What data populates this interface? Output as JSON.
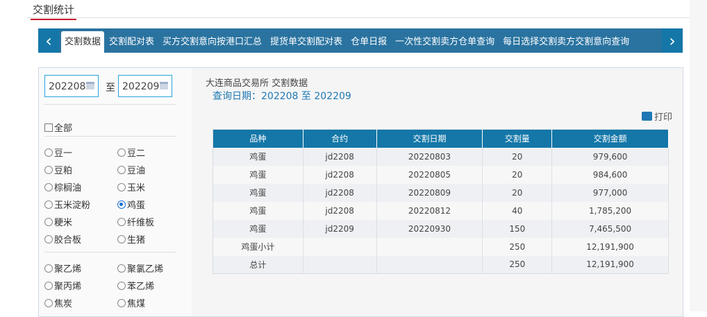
{
  "page_title": "交割统计",
  "tabs": [
    "交割数据",
    "交割配对表",
    "买方交割意向按港口汇总",
    "提货单交割配对表",
    "仓单日报",
    "一次性交割卖方仓单查询",
    "每日选择交割卖方交割意向查询"
  ],
  "filter": {
    "start": "202208",
    "to": "至",
    "end": "202209",
    "all_label": "全部",
    "group1": [
      {
        "label": "豆一",
        "checked": false
      },
      {
        "label": "豆二",
        "checked": false
      },
      {
        "label": "豆粕",
        "checked": false
      },
      {
        "label": "豆油",
        "checked": false
      },
      {
        "label": "棕榈油",
        "checked": false
      },
      {
        "label": "玉米",
        "checked": false
      },
      {
        "label": "玉米淀粉",
        "checked": false
      },
      {
        "label": "鸡蛋",
        "checked": true
      },
      {
        "label": "粳米",
        "checked": false
      },
      {
        "label": "纤维板",
        "checked": false
      },
      {
        "label": "胶合板",
        "checked": false
      },
      {
        "label": "生猪",
        "checked": false
      }
    ],
    "group2": [
      {
        "label": "聚乙烯",
        "checked": false
      },
      {
        "label": "聚氯乙烯",
        "checked": false
      },
      {
        "label": "聚丙烯",
        "checked": false
      },
      {
        "label": "苯乙烯",
        "checked": false
      },
      {
        "label": "焦炭",
        "checked": false
      },
      {
        "label": "焦煤",
        "checked": false
      }
    ]
  },
  "report": {
    "heading": "大连商品交易所 交割数据",
    "query_date": "查询日期：202208 至 202209",
    "print_label": "打印",
    "columns": [
      "品种",
      "合约",
      "交割日期",
      "交割量",
      "交割金额"
    ],
    "rows": [
      [
        "鸡蛋",
        "jd2208",
        "20220803",
        "20",
        "979,600"
      ],
      [
        "鸡蛋",
        "jd2208",
        "20220805",
        "20",
        "984,600"
      ],
      [
        "鸡蛋",
        "jd2208",
        "20220809",
        "20",
        "977,000"
      ],
      [
        "鸡蛋",
        "jd2208",
        "20220812",
        "40",
        "1,785,200"
      ],
      [
        "鸡蛋",
        "jd2209",
        "20220930",
        "150",
        "7,465,500"
      ],
      [
        "鸡蛋小计",
        "",
        "",
        "250",
        "12,191,900"
      ],
      [
        "总计",
        "",
        "",
        "250",
        "12,191,900"
      ]
    ]
  }
}
